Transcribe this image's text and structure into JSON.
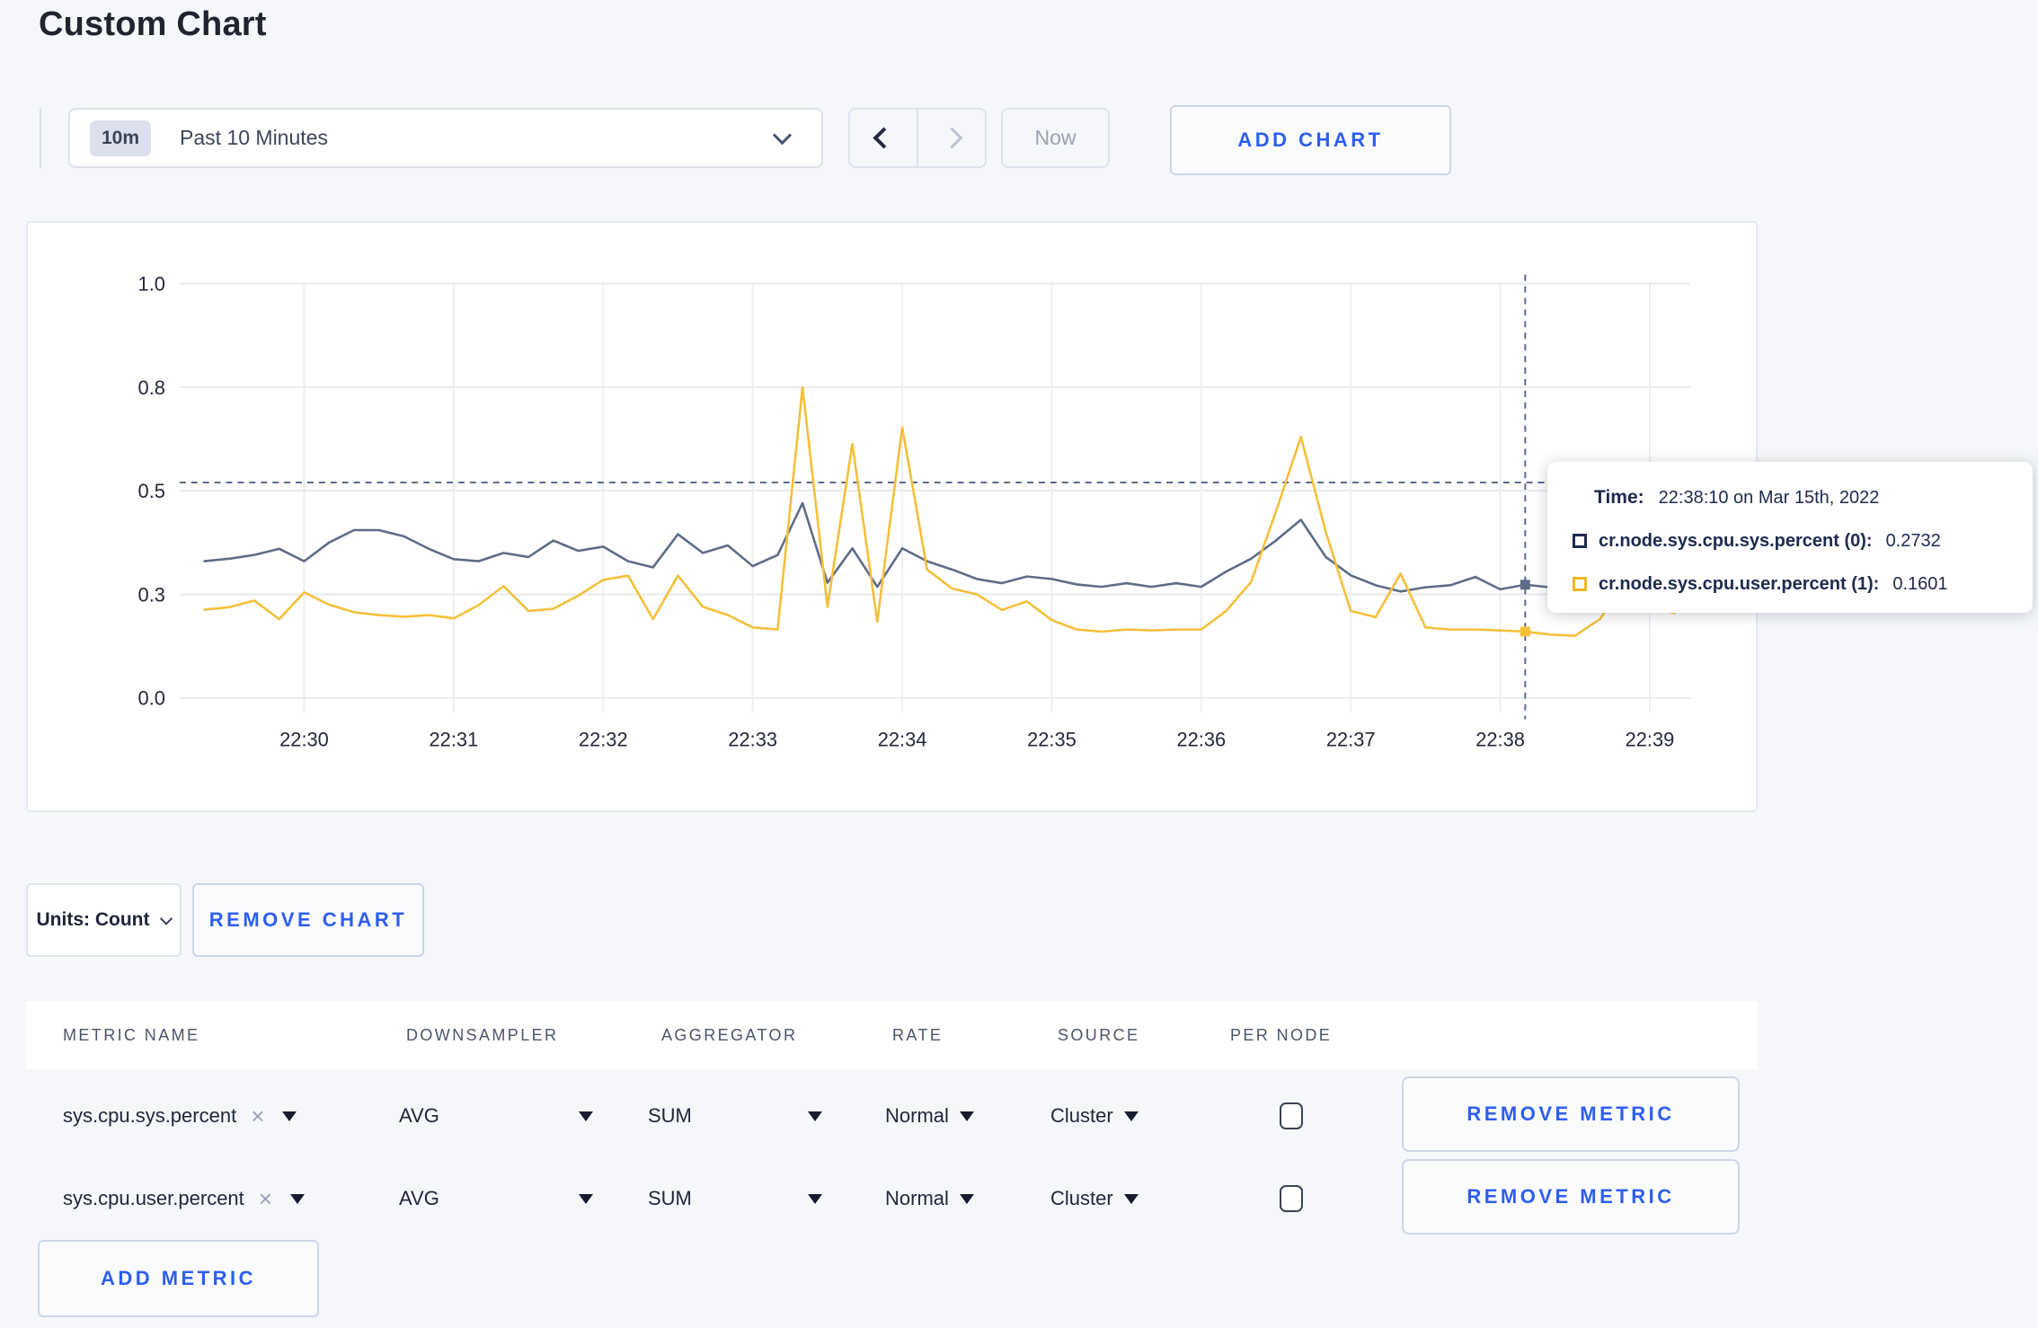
{
  "page": {
    "title": "Custom Chart"
  },
  "toolbar": {
    "time_selector": {
      "badge": "10m",
      "label": "Past 10 Minutes"
    },
    "now_label": "Now",
    "add_chart_label": "ADD CHART"
  },
  "chart_controls": {
    "units_label": "Units: Count",
    "remove_chart_label": "REMOVE CHART"
  },
  "tooltip": {
    "time_label": "Time:",
    "time_value": "22:38:10 on Mar 15th, 2022",
    "series": [
      {
        "label": "cr.node.sys.cpu.sys.percent (0):",
        "value": "0.2732",
        "color": "#1f2a4d"
      },
      {
        "label": "cr.node.sys.cpu.user.percent (1):",
        "value": "0.1601",
        "color": "#f0b824"
      }
    ]
  },
  "metrics_table": {
    "columns": [
      "METRIC NAME",
      "DOWNSAMPLER",
      "AGGREGATOR",
      "RATE",
      "SOURCE",
      "PER NODE"
    ],
    "remove_icon": "×",
    "rows": [
      {
        "metric": "sys.cpu.sys.percent",
        "downsampler": "AVG",
        "aggregator": "SUM",
        "rate": "Normal",
        "source": "Cluster",
        "per_node": false,
        "remove_label": "REMOVE METRIC"
      },
      {
        "metric": "sys.cpu.user.percent",
        "downsampler": "AVG",
        "aggregator": "SUM",
        "rate": "Normal",
        "source": "Cluster",
        "per_node": false,
        "remove_label": "REMOVE METRIC"
      }
    ],
    "add_metric_label": "ADD METRIC"
  },
  "chart_data": {
    "type": "line",
    "title": "",
    "xlabel": "",
    "ylabel": "",
    "ylim": [
      0,
      1
    ],
    "grid": true,
    "legend_position": "none",
    "y_ticks": [
      {
        "value": 0,
        "label": "0.0"
      },
      {
        "value": 0.25,
        "label": "0.3"
      },
      {
        "value": 0.5,
        "label": "0.5"
      },
      {
        "value": 0.75,
        "label": "0.8"
      },
      {
        "value": 1,
        "label": "1.0"
      }
    ],
    "x_tick_labels": [
      "22:30",
      "22:31",
      "22:32",
      "22:33",
      "22:34",
      "22:35",
      "22:36",
      "22:37",
      "22:38",
      "22:39"
    ],
    "times": [
      "22:29:20",
      "22:29:30",
      "22:29:40",
      "22:29:50",
      "22:30:00",
      "22:30:10",
      "22:30:20",
      "22:30:30",
      "22:30:40",
      "22:30:50",
      "22:31:00",
      "22:31:10",
      "22:31:20",
      "22:31:30",
      "22:31:40",
      "22:31:50",
      "22:32:00",
      "22:32:10",
      "22:32:20",
      "22:32:30",
      "22:32:40",
      "22:32:50",
      "22:33:00",
      "22:33:10",
      "22:33:20",
      "22:33:30",
      "22:33:40",
      "22:33:50",
      "22:34:00",
      "22:34:10",
      "22:34:20",
      "22:34:30",
      "22:34:40",
      "22:34:50",
      "22:35:00",
      "22:35:10",
      "22:35:20",
      "22:35:30",
      "22:35:40",
      "22:35:50",
      "22:36:00",
      "22:36:10",
      "22:36:20",
      "22:36:30",
      "22:36:40",
      "22:36:50",
      "22:37:00",
      "22:37:10",
      "22:37:20",
      "22:37:30",
      "22:37:40",
      "22:37:50",
      "22:38:00",
      "22:38:10",
      "22:38:20",
      "22:38:30",
      "22:38:40",
      "22:38:50",
      "22:39:00",
      "22:39:10"
    ],
    "series": [
      {
        "name": "cr.node.sys.cpu.sys.percent",
        "color": "#5f6c87",
        "values": [
          0.33,
          0.336,
          0.345,
          0.36,
          0.33,
          0.375,
          0.405,
          0.405,
          0.39,
          0.36,
          0.335,
          0.33,
          0.35,
          0.34,
          0.38,
          0.355,
          0.365,
          0.33,
          0.315,
          0.395,
          0.35,
          0.368,
          0.318,
          0.345,
          0.47,
          0.278,
          0.361,
          0.268,
          0.361,
          0.33,
          0.31,
          0.287,
          0.277,
          0.293,
          0.287,
          0.274,
          0.268,
          0.277,
          0.268,
          0.277,
          0.268,
          0.305,
          0.336,
          0.38,
          0.43,
          0.34,
          0.296,
          0.272,
          0.257,
          0.267,
          0.272,
          0.292,
          0.262,
          0.2732,
          0.267,
          0.272,
          0.264,
          0.3,
          0.302,
          0.315
        ]
      },
      {
        "name": "cr.node.sys.cpu.user.percent",
        "color": "#f5bf39",
        "values": [
          0.213,
          0.219,
          0.235,
          0.19,
          0.255,
          0.225,
          0.207,
          0.2,
          0.196,
          0.2,
          0.192,
          0.224,
          0.27,
          0.21,
          0.215,
          0.247,
          0.285,
          0.295,
          0.19,
          0.295,
          0.22,
          0.2,
          0.17,
          0.165,
          0.75,
          0.22,
          0.613,
          0.184,
          0.653,
          0.31,
          0.264,
          0.25,
          0.212,
          0.233,
          0.188,
          0.165,
          0.16,
          0.165,
          0.163,
          0.165,
          0.165,
          0.21,
          0.28,
          0.45,
          0.63,
          0.4,
          0.21,
          0.195,
          0.3,
          0.17,
          0.165,
          0.165,
          0.163,
          0.1601,
          0.153,
          0.15,
          0.19,
          0.28,
          0.22,
          0.205
        ]
      }
    ],
    "crosshair": {
      "time": "22:38:10",
      "guide_y": 0.52,
      "points": [
        {
          "series": 0,
          "value": 0.2732
        },
        {
          "series": 1,
          "value": 0.1601
        }
      ]
    }
  }
}
